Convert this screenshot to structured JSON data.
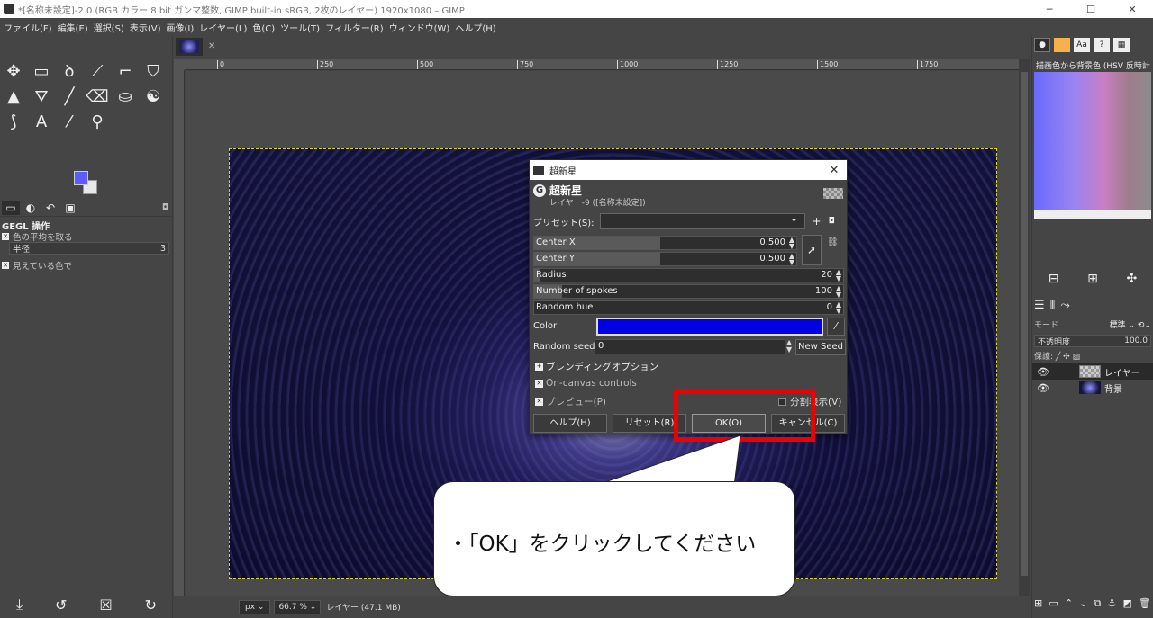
{
  "window": {
    "title": "*[名称未設定]-2.0 (RGB カラー 8 bit ガンマ整数, GIMP built-in sRGB, 2枚のレイヤー) 1920x1080 – GIMP",
    "min": "─",
    "max": "☐",
    "close": "✕"
  },
  "menu": [
    "ファイル(F)",
    "編集(E)",
    "選択(S)",
    "表示(V)",
    "画像(I)",
    "レイヤー(L)",
    "色(C)",
    "ツール(T)",
    "フィルター(R)",
    "ウィンドウ(W)",
    "ヘルプ(H)"
  ],
  "toolbox": {
    "tools": [
      "move-icon",
      "rect-select-icon",
      "lasso-icon",
      "fuzzy-select-icon",
      "crop-icon",
      "unified-transform-icon",
      "warp-icon",
      "bucket-fill-icon",
      "paintbrush-icon",
      "eraser-icon",
      "clone-icon",
      "smudge-icon",
      "paths-icon",
      "text-icon",
      "color-picker-icon",
      "zoom-icon"
    ],
    "tool_glyphs": [
      "✥",
      "▭",
      "ꝺ",
      "⟋",
      "⌐",
      "⛉",
      "▲",
      "⛛",
      "╱",
      "⌫",
      "⛀",
      "☯",
      "⟆",
      "A",
      "⁄",
      "⚲"
    ],
    "fg_color": "#5b5bff",
    "bg_color": "#e8e8e8",
    "panel_title": "GEGL 操作",
    "option_average": "色の平均を取る",
    "radius_label": "半径",
    "radius_value": "3",
    "option_visible": "見えている色で",
    "dock_menu": "◘"
  },
  "image_tab": {
    "close": "✕"
  },
  "ruler": {
    "ticks": [
      "0",
      "250",
      "500",
      "750",
      "1000",
      "1250",
      "1500",
      "1750"
    ]
  },
  "status": {
    "unit": "px ⌄",
    "zoom": "66.7 % ⌄",
    "info": "レイヤー (47.1 MB)"
  },
  "rightdock": {
    "gradient_label": "描画色から背景色 (HSV 反時計",
    "tab_glyphs": [
      "●",
      "",
      "Aa",
      "?",
      "▦"
    ],
    "mode_label": "モード",
    "mode_value": "標準 ⌄ ⟲⌄",
    "opacity_label": "不透明度",
    "opacity_value": "100.0",
    "lock_label": "保護: ╱ ✣ ▨",
    "layers": [
      {
        "name": "レイヤー",
        "thumb": "trans",
        "selected": true
      },
      {
        "name": "背景",
        "thumb": "dark",
        "selected": false
      }
    ]
  },
  "dialog": {
    "titlebar": "超新星",
    "title": "超新星",
    "subtitle": "レイヤー-9 ([名称未設定])",
    "preset_label": "プリセット(S):",
    "preset_value": "",
    "center_x_label": "Center X",
    "center_x_value": "0.500",
    "center_y_label": "Center Y",
    "center_y_value": "0.500",
    "radius_label": "Radius",
    "radius_value": "20",
    "spokes_label": "Number of spokes",
    "spokes_value": "100",
    "hue_label": "Random hue",
    "hue_value": "0",
    "color_label": "Color",
    "color_value": "#0000e0",
    "seed_label": "Random seed",
    "seed_value": "0",
    "new_seed": "New Seed",
    "blending": "ブレンディングオプション",
    "on_canvas": "On-canvas controls",
    "preview": "プレビュー(P)",
    "split_view": "分割表示(V)",
    "help": "ヘルプ(H)",
    "reset": "リセット(R)",
    "ok": "OK(O)",
    "cancel": "キャンセル(C)"
  },
  "callout": {
    "text": "・「OK」をクリックしてください"
  },
  "colors": {
    "highlight": "#ee0000",
    "accent": "#0000e0"
  }
}
